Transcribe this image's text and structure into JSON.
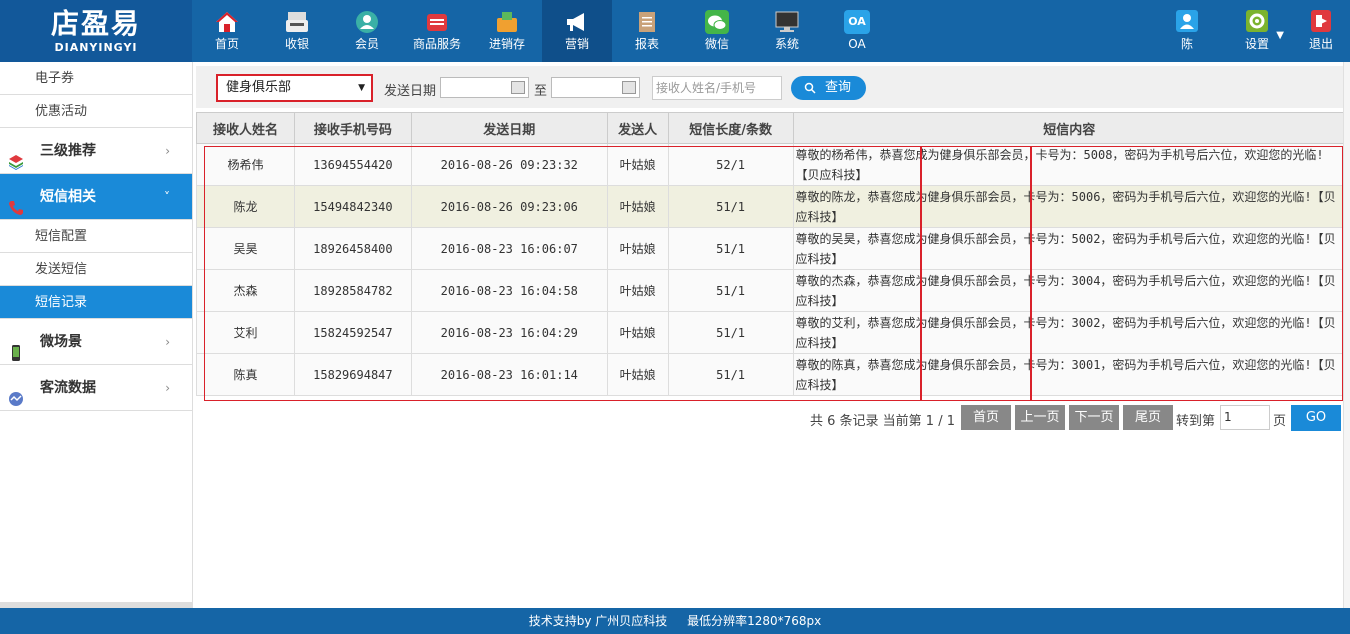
{
  "brand": {
    "logo_text": "店盈易",
    "logo_sub": "DIANYINGYI"
  },
  "nav": [
    {
      "label": "首页",
      "icon": "home-icon"
    },
    {
      "label": "收银",
      "icon": "cash-register-icon"
    },
    {
      "label": "会员",
      "icon": "member-icon"
    },
    {
      "label": "商品服务",
      "icon": "goods-icon"
    },
    {
      "label": "进销存",
      "icon": "inventory-icon"
    },
    {
      "label": "营销",
      "icon": "megaphone-icon"
    },
    {
      "label": "报表",
      "icon": "report-icon"
    },
    {
      "label": "微信",
      "icon": "wechat-icon"
    },
    {
      "label": "系统",
      "icon": "monitor-icon"
    },
    {
      "label": "OA",
      "icon": "oa-icon",
      "icon_text": "OA"
    }
  ],
  "user": {
    "name": "陈",
    "settings_label": "设置",
    "logout_label": "退出"
  },
  "sidebar": {
    "top_items": [
      "电子券",
      "优惠活动"
    ],
    "groups": [
      {
        "label": "三级推荐",
        "chevron": "›"
      },
      {
        "label": "短信相关",
        "chevron": "˅"
      },
      {
        "label": "微场景",
        "chevron": "›"
      },
      {
        "label": "客流数据",
        "chevron": "›"
      }
    ],
    "sms_items": [
      "短信配置",
      "发送短信",
      "短信记录"
    ]
  },
  "filters": {
    "shop_selected": "健身俱乐部",
    "date_label": "发送日期",
    "date_from": "",
    "to_label": "至",
    "date_to": "",
    "keyword_placeholder": "接收人姓名/手机号",
    "query_label": "查询"
  },
  "table": {
    "headers": [
      "接收人姓名",
      "接收手机号码",
      "发送日期",
      "发送人",
      "短信长度/条数",
      "短信内容"
    ],
    "rows": [
      {
        "name": "杨希伟",
        "phone": "13694554420",
        "date": "2016-08-26 09:23:32",
        "sender": "叶姑娘",
        "length": "52/1",
        "content": "尊敬的杨希伟，恭喜您成为健身俱乐部会员，卡号为：5008，密码为手机号后六位，欢迎您的光临!【贝应科技】"
      },
      {
        "name": "陈龙",
        "phone": "15494842340",
        "date": "2016-08-26 09:23:06",
        "sender": "叶姑娘",
        "length": "51/1",
        "content": "尊敬的陈龙，恭喜您成为健身俱乐部会员，卡号为：5006，密码为手机号后六位，欢迎您的光临!【贝应科技】"
      },
      {
        "name": "吴昊",
        "phone": "18926458400",
        "date": "2016-08-23 16:06:07",
        "sender": "叶姑娘",
        "length": "51/1",
        "content": "尊敬的吴昊，恭喜您成为健身俱乐部会员，卡号为：5002，密码为手机号后六位，欢迎您的光临!【贝应科技】"
      },
      {
        "name": "杰森",
        "phone": "18928584782",
        "date": "2016-08-23 16:04:58",
        "sender": "叶姑娘",
        "length": "51/1",
        "content": "尊敬的杰森，恭喜您成为健身俱乐部会员，卡号为：3004，密码为手机号后六位，欢迎您的光临!【贝应科技】"
      },
      {
        "name": "艾利",
        "phone": "15824592547",
        "date": "2016-08-23 16:04:29",
        "sender": "叶姑娘",
        "length": "51/1",
        "content": "尊敬的艾利，恭喜您成为健身俱乐部会员，卡号为：3002，密码为手机号后六位，欢迎您的光临!【贝应科技】"
      },
      {
        "name": "陈真",
        "phone": "15829694847",
        "date": "2016-08-23 16:01:14",
        "sender": "叶姑娘",
        "length": "51/1",
        "content": "尊敬的陈真，恭喜您成为健身俱乐部会员，卡号为：3001，密码为手机号后六位，欢迎您的光临!【贝应科技】"
      }
    ]
  },
  "pager": {
    "info": "共 6 条记录 当前第 1 / 1",
    "first": "首页",
    "prev": "上一页",
    "next": "下一页",
    "last": "尾页",
    "jump_label": "转到第",
    "page_value": "1",
    "page_unit": "页",
    "go": "GO"
  },
  "footer": {
    "support": "技术支持by 广州贝应科技",
    "resolution": "最低分辨率1280*768px"
  },
  "colors": {
    "topbar": "#1565a6",
    "accent": "#1a8ad8",
    "highlight": "#d9212a"
  }
}
